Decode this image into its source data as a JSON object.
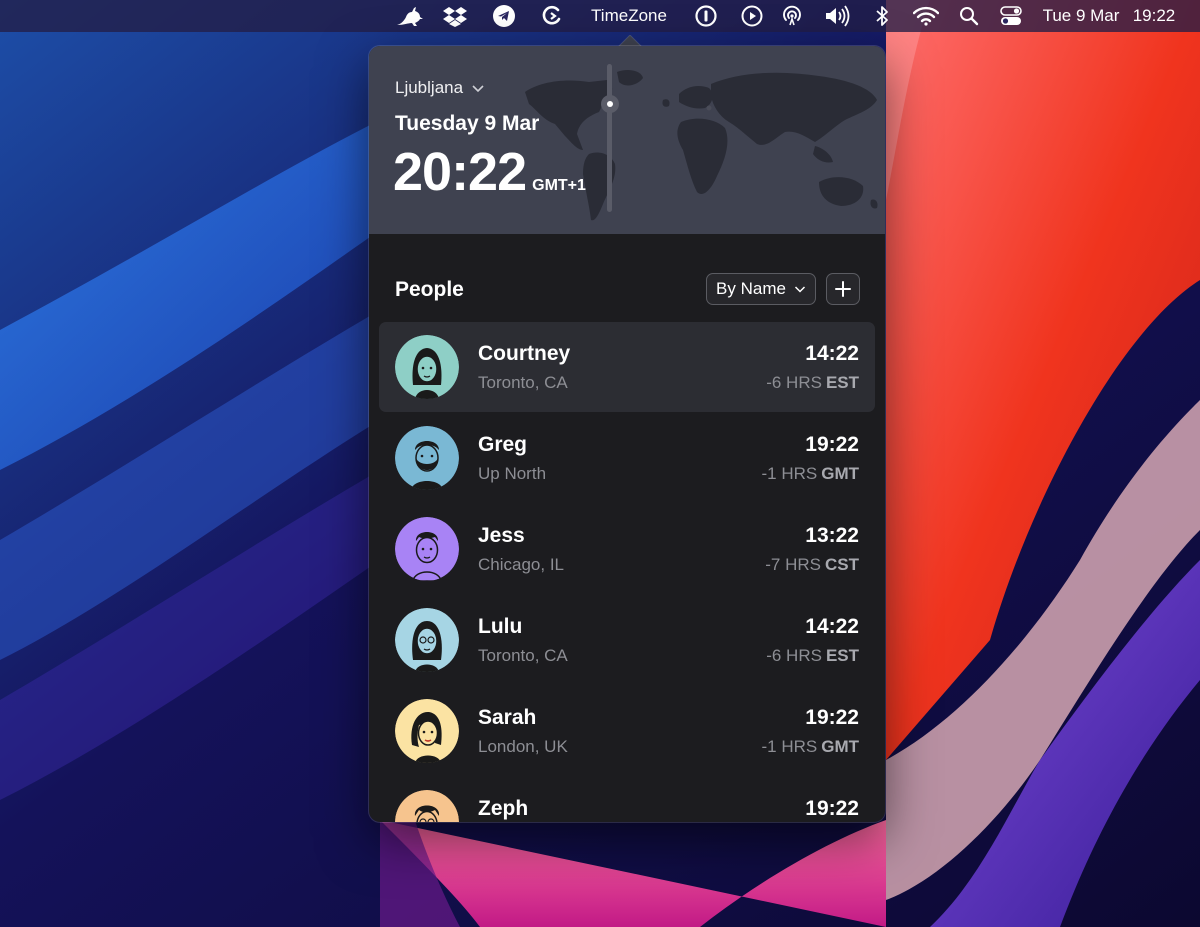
{
  "menubar": {
    "items": [
      {
        "icon": "kangaroo-icon"
      },
      {
        "icon": "dropbox-icon"
      },
      {
        "icon": "telegram-icon"
      },
      {
        "icon": "reload-arc-icon"
      }
    ],
    "app_title": "TimeZone",
    "status_icons": [
      "onepassword-icon",
      "play-icon",
      "airdrop-icon",
      "volume-icon",
      "bluetooth-icon",
      "wifi-icon",
      "search-icon",
      "control-center-icon"
    ],
    "date": "Tue 9 Mar",
    "time": "19:22"
  },
  "header": {
    "city": "Ljubljana",
    "date": "Tuesday 9 Mar",
    "time": "20:22",
    "timezone": "GMT+1"
  },
  "people": {
    "title": "People",
    "sort_label": "By Name",
    "add_icon": "plus-icon",
    "list": [
      {
        "name": "Courtney",
        "location": "Toronto, CA",
        "time": "14:22",
        "offset": "-6 HRS",
        "tz": "EST",
        "selected": true,
        "avatar_color": "#8ecfc6"
      },
      {
        "name": "Greg",
        "location": "Up North",
        "time": "19:22",
        "offset": "-1 HRS",
        "tz": "GMT",
        "avatar_color": "#7ab8d4"
      },
      {
        "name": "Jess",
        "location": "Chicago, IL",
        "time": "13:22",
        "offset": "-7 HRS",
        "tz": "CST",
        "avatar_color": "#a883f5"
      },
      {
        "name": "Lulu",
        "location": "Toronto, CA",
        "time": "14:22",
        "offset": "-6 HRS",
        "tz": "EST",
        "avatar_color": "#a6d5e4"
      },
      {
        "name": "Sarah",
        "location": "London, UK",
        "time": "19:22",
        "offset": "-1 HRS",
        "tz": "GMT",
        "avatar_color": "#fbe3a3"
      },
      {
        "name": "Zeph",
        "location": "",
        "time": "19:22",
        "offset": "",
        "tz": "",
        "avatar_color": "#f6c48e"
      }
    ]
  },
  "colors": {
    "popover_bg": "#1c1c1f",
    "header_bg": "#3f4250",
    "row_selected": "#2c2d33",
    "secondary_text": "#8d8e94"
  }
}
